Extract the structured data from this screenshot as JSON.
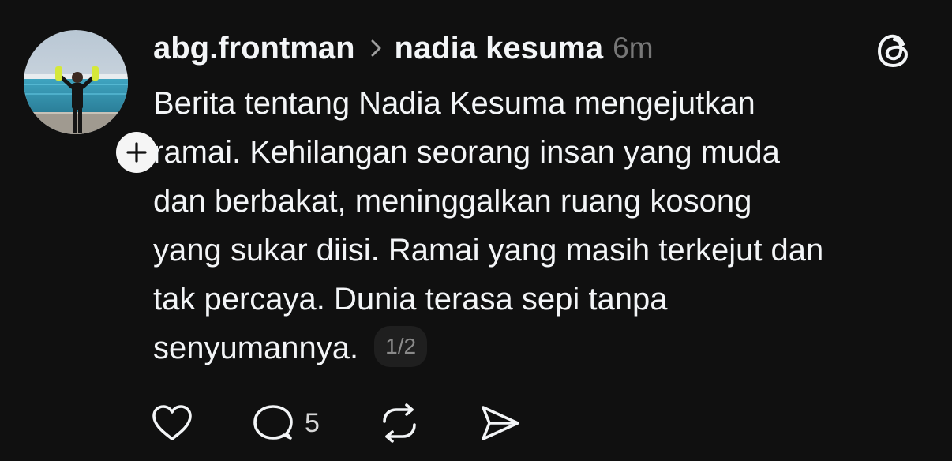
{
  "post": {
    "username": "abg.frontman",
    "reply_to": "nadia kesuma",
    "time": "6m",
    "text_lines": [
      "Berita tentang Nadia Kesuma mengejutkan",
      "ramai. Kehilangan seorang insan yang muda",
      "dan berbakat, meninggalkan ruang kosong",
      "yang sukar diisi. Ramai yang masih terkejut dan",
      "tak percaya. Dunia terasa sepi tanpa",
      "senyumannya."
    ],
    "page_indicator": "1/2"
  },
  "actions": {
    "like_icon": "heart-icon",
    "reply_icon": "comment-icon",
    "reply_count": "5",
    "repost_icon": "repost-icon",
    "share_icon": "send-icon"
  },
  "icons": {
    "follow": "plus-icon",
    "app": "threads-logo-icon",
    "separator": "chevron-right-icon"
  },
  "colors": {
    "background": "#101010",
    "text": "#f3f5f7",
    "muted": "#777777",
    "pill_bg": "#1f1f1f"
  }
}
